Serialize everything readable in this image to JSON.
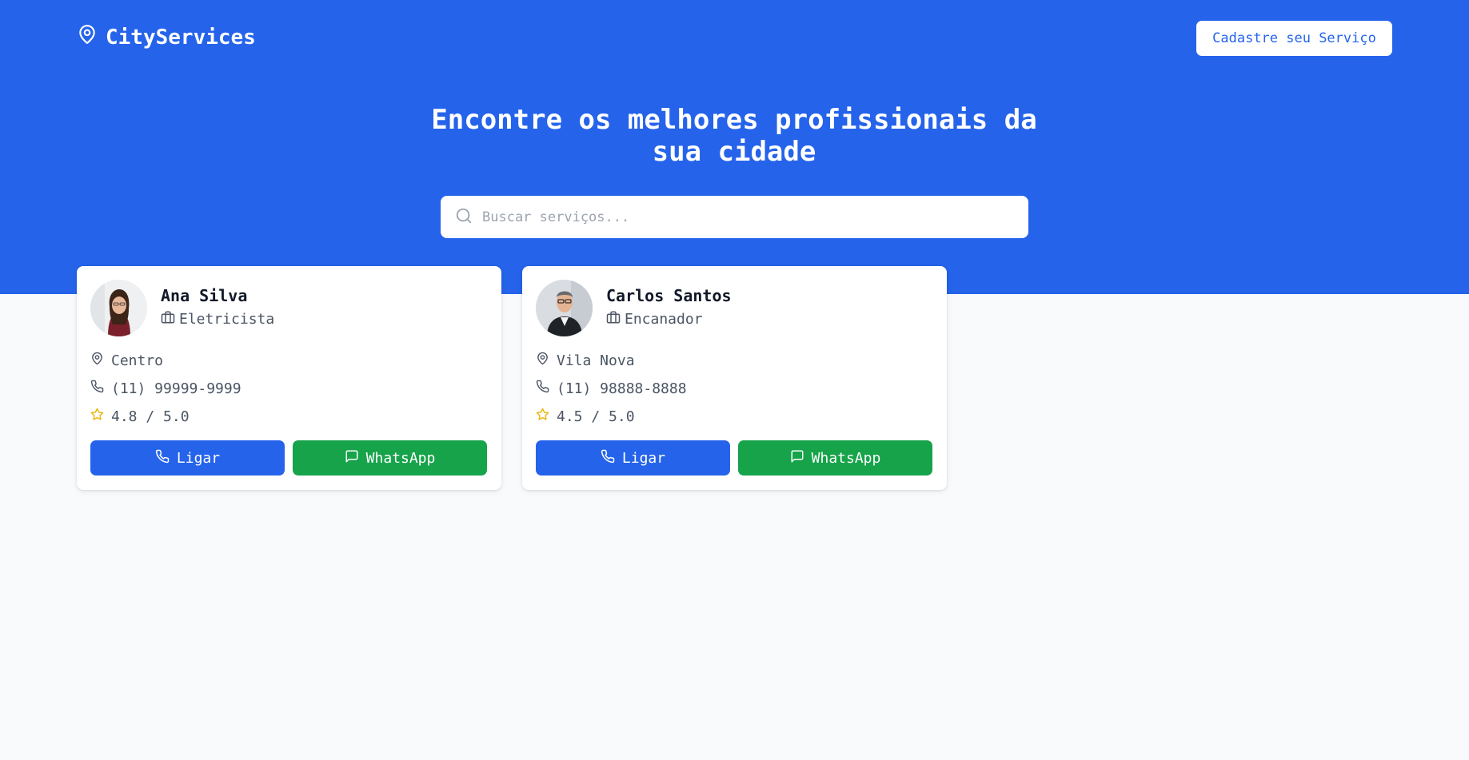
{
  "header": {
    "brand": "CityServices",
    "register_button": "Cadastre seu Serviço"
  },
  "hero": {
    "title_line1": "Encontre os melhores profissionais da",
    "title_line2": "sua cidade",
    "search_placeholder": "Buscar serviços..."
  },
  "providers": [
    {
      "name": "Ana Silva",
      "profession": "Eletricista",
      "location": "Centro",
      "phone": "(11) 99999-9999",
      "rating": "4.8 / 5.0",
      "call_label": "Ligar",
      "whatsapp_label": "WhatsApp"
    },
    {
      "name": "Carlos Santos",
      "profession": "Encanador",
      "location": "Vila Nova",
      "phone": "(11) 98888-8888",
      "rating": "4.5 / 5.0",
      "call_label": "Ligar",
      "whatsapp_label": "WhatsApp"
    }
  ],
  "icons": {
    "brand": "map-pin-icon",
    "search": "search-icon",
    "profession": "briefcase-icon",
    "location": "map-pin-icon",
    "phone": "phone-icon",
    "rating": "star-icon",
    "whatsapp": "message-square-icon"
  },
  "colors": {
    "primary": "#2563eb",
    "whatsapp": "#16a34a",
    "star": "#eab308",
    "background": "#f9fafb"
  }
}
